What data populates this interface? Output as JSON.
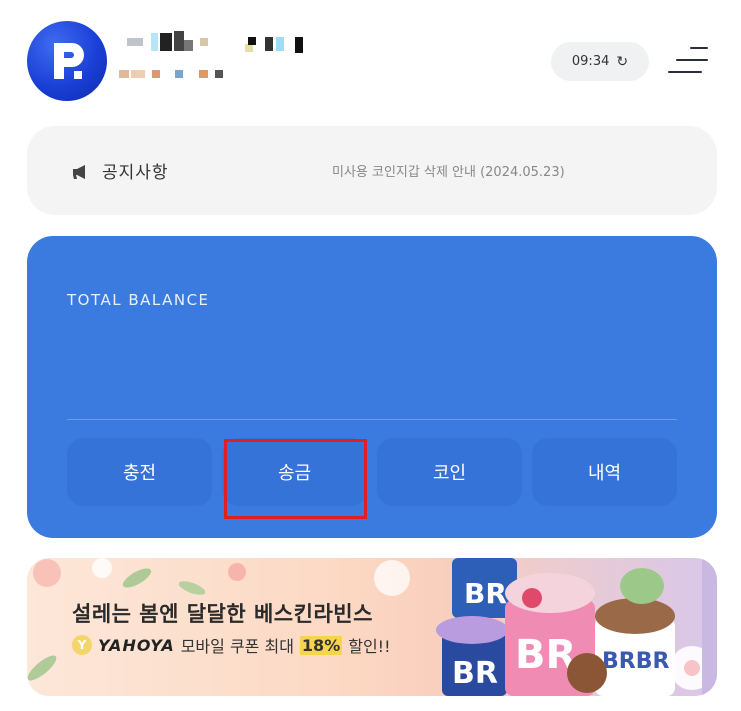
{
  "header": {
    "timer": "09:34",
    "refresh_icon": "refresh-icon",
    "menu_icon": "hamburger-menu-icon"
  },
  "notice": {
    "label": "공지사항",
    "text": "미사용 코인지갑 삭제 안내 (2024.05.23)"
  },
  "balance": {
    "label": "TOTAL BALANCE",
    "actions": [
      {
        "label": "충전"
      },
      {
        "label": "송금"
      },
      {
        "label": "코인"
      },
      {
        "label": "내역"
      }
    ]
  },
  "banner": {
    "title": "설레는 봄엔 달달한 베스킨라빈스",
    "brand": "YAHOYA",
    "subtitle_pre": "모바일 쿠폰 최대",
    "discount": "18%",
    "subtitle_post": "할인!!"
  },
  "colors": {
    "primary": "#3b7be0",
    "button": "#3573d8",
    "highlight": "#e02020"
  }
}
